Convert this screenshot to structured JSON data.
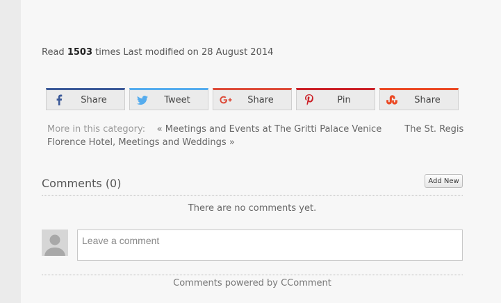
{
  "read_line": {
    "prefix": "Read",
    "count": "1503",
    "suffix": "times Last modified on 28 August 2014"
  },
  "share_buttons": [
    {
      "label": "Share",
      "network": "facebook",
      "icon": "facebook-icon",
      "color": "#3b5998"
    },
    {
      "label": "Tweet",
      "network": "twitter",
      "icon": "twitter-icon",
      "color": "#55acee"
    },
    {
      "label": "Share",
      "network": "google-plus",
      "icon": "google-plus-icon",
      "color": "#dd4b39"
    },
    {
      "label": "Pin",
      "network": "pinterest",
      "icon": "pinterest-icon",
      "color": "#cb2027"
    },
    {
      "label": "Share",
      "network": "stumbleupon",
      "icon": "stumbleupon-icon",
      "color": "#eb4924"
    }
  ],
  "more_category": {
    "label": "More in this category:",
    "prev": "« Meetings and Events at The Gritti Palace Venice",
    "next": "The St. Regis Florence Hotel, Meetings and Weddings »"
  },
  "comments": {
    "title": "Comments (0)",
    "add_new": "Add New",
    "empty": "There are no comments yet.",
    "placeholder": "Leave a comment",
    "powered_prefix": "Comments powered by",
    "powered_link": "CComment"
  }
}
